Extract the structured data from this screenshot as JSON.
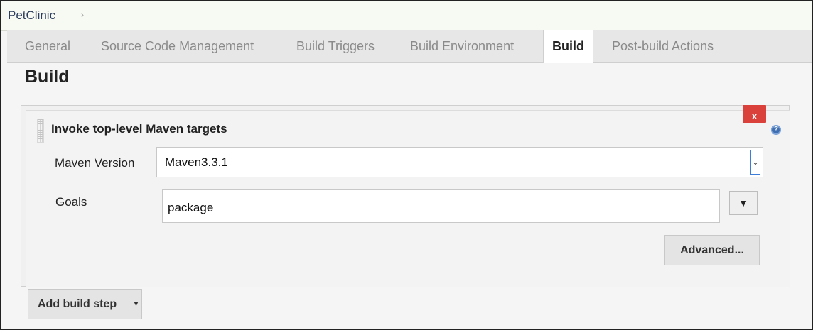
{
  "breadcrumb": {
    "item": "PetClinic",
    "separator": "›"
  },
  "tabs": [
    {
      "label": "General",
      "active": false
    },
    {
      "label": "Source Code Management",
      "active": false
    },
    {
      "label": "Build Triggers",
      "active": false
    },
    {
      "label": "Build Environment",
      "active": false
    },
    {
      "label": "Build",
      "active": true
    },
    {
      "label": "Post-build Actions",
      "active": false
    }
  ],
  "section": {
    "title": "Build"
  },
  "build_step": {
    "title": "Invoke top-level Maven targets",
    "delete_label": "x",
    "help_icon": "question-circle-icon",
    "maven_version": {
      "label": "Maven Version",
      "value": "Maven3.3.1",
      "arrow": "⌄"
    },
    "goals": {
      "label": "Goals",
      "value": "package",
      "expand_glyph": "▼"
    },
    "advanced_label": "Advanced..."
  },
  "add_build_step": {
    "label": "Add build step",
    "caret": "▾"
  },
  "colors": {
    "delete_red": "#d9413a",
    "help_blue": "#3f6fb0",
    "select_focus": "#3c7dd9"
  }
}
